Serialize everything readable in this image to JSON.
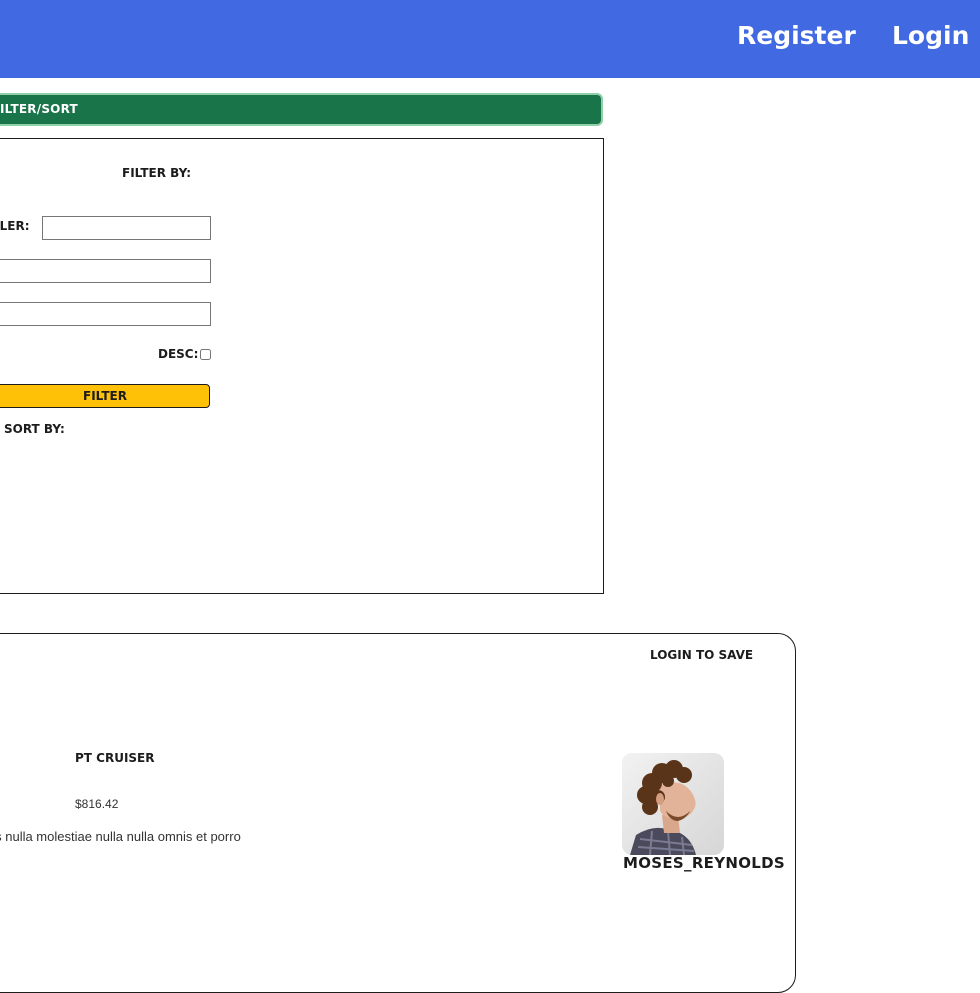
{
  "navbar": {
    "color": "#4169e1",
    "register_label": "Register",
    "login_label": "Login"
  },
  "filter_sort": {
    "header_label": "ilter/Sort",
    "header_color": "#19744a",
    "filter_by_label": "Filter By:",
    "seller_label": "ller:",
    "seller_value": "",
    "field2_value": "",
    "field3_value": "",
    "desc_label": "Desc:",
    "desc_checked": false,
    "filter_button_label": "Filter",
    "filter_button_color": "#ffc107",
    "sort_by_label": "Sort By:"
  },
  "listing": {
    "save_label": "Login To Save",
    "product_name": "PT Cruiser",
    "price": "$816.42",
    "description": "nis nulla molestiae nulla nulla omnis et porro",
    "seller_name": "moses_reynolds",
    "avatar_icon": "seller-avatar-photo"
  }
}
